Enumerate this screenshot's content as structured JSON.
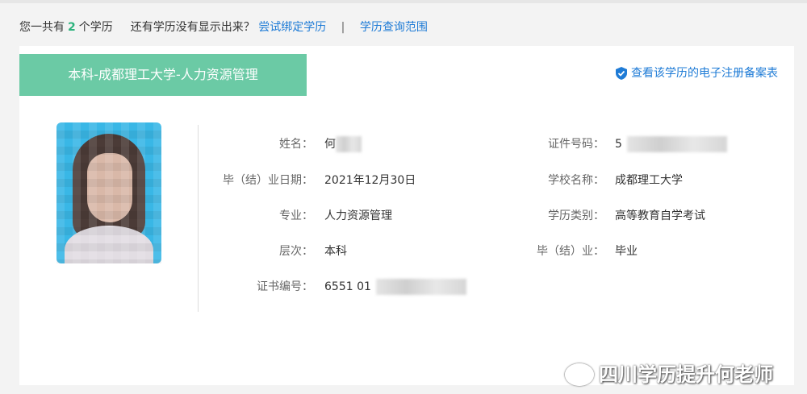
{
  "summary": {
    "prefix": "您一共有",
    "count": "2",
    "suffix": "个学历",
    "not_shown": "还有学历没有显示出来？",
    "bind_link": "尝试绑定学历",
    "separator": "|",
    "scope_link": "学历查询范围"
  },
  "card": {
    "tab_title": "本科-成都理工大学-人力资源管理",
    "verify_link": "查看该学历的电子注册备案表",
    "fields_left": [
      {
        "label": "姓名：",
        "value": "何"
      },
      {
        "label": "毕（结）业日期：",
        "value": "2021年12月30日"
      },
      {
        "label": "专业：",
        "value": "人力资源管理"
      },
      {
        "label": "层次：",
        "value": "本科"
      },
      {
        "label": "证书编号：",
        "value": "6551 01"
      }
    ],
    "fields_right": [
      {
        "label": "证件号码：",
        "value": "5"
      },
      {
        "label": "学校名称：",
        "value": "成都理工大学"
      },
      {
        "label": "学历类别：",
        "value": "高等教育自学考试"
      },
      {
        "label": "毕（结）业：",
        "value": "毕业"
      }
    ]
  },
  "watermark": {
    "text": "四川学历提升何老师"
  },
  "icons": {
    "verify": "shield-check-icon",
    "watermark_logo": "weibo-logo-icon"
  },
  "colors": {
    "accent_green": "#6bcaa5",
    "count_green": "#2bb27c",
    "link_blue": "#1e7bd6"
  }
}
